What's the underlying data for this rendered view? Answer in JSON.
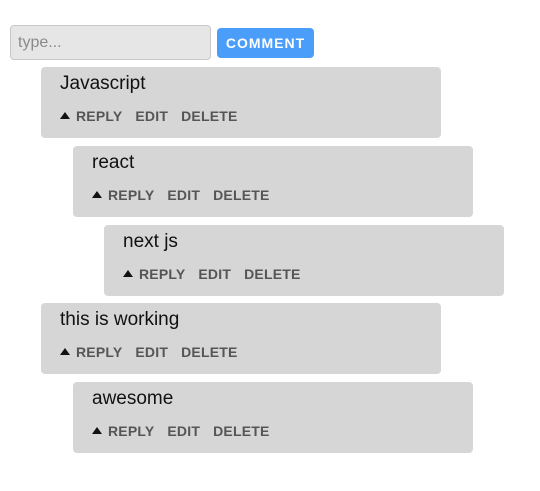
{
  "composer": {
    "placeholder": "type...",
    "value": "",
    "button_label": "COMMENT",
    "button_color": "#4a9df9"
  },
  "actions": {
    "reply": "REPLY",
    "edit": "EDIT",
    "delete": "DELETE",
    "reply_icon": "caret-up-icon"
  },
  "comments": [
    {
      "text": "Javascript",
      "depth": 0
    },
    {
      "text": "react",
      "depth": 1
    },
    {
      "text": "next js",
      "depth": 2
    },
    {
      "text": "this is working",
      "depth": 0
    },
    {
      "text": "awesome",
      "depth": 1
    }
  ],
  "colors": {
    "card_background": "#d6d6d6",
    "input_background": "#e6e6e6",
    "action_text": "#555555"
  }
}
